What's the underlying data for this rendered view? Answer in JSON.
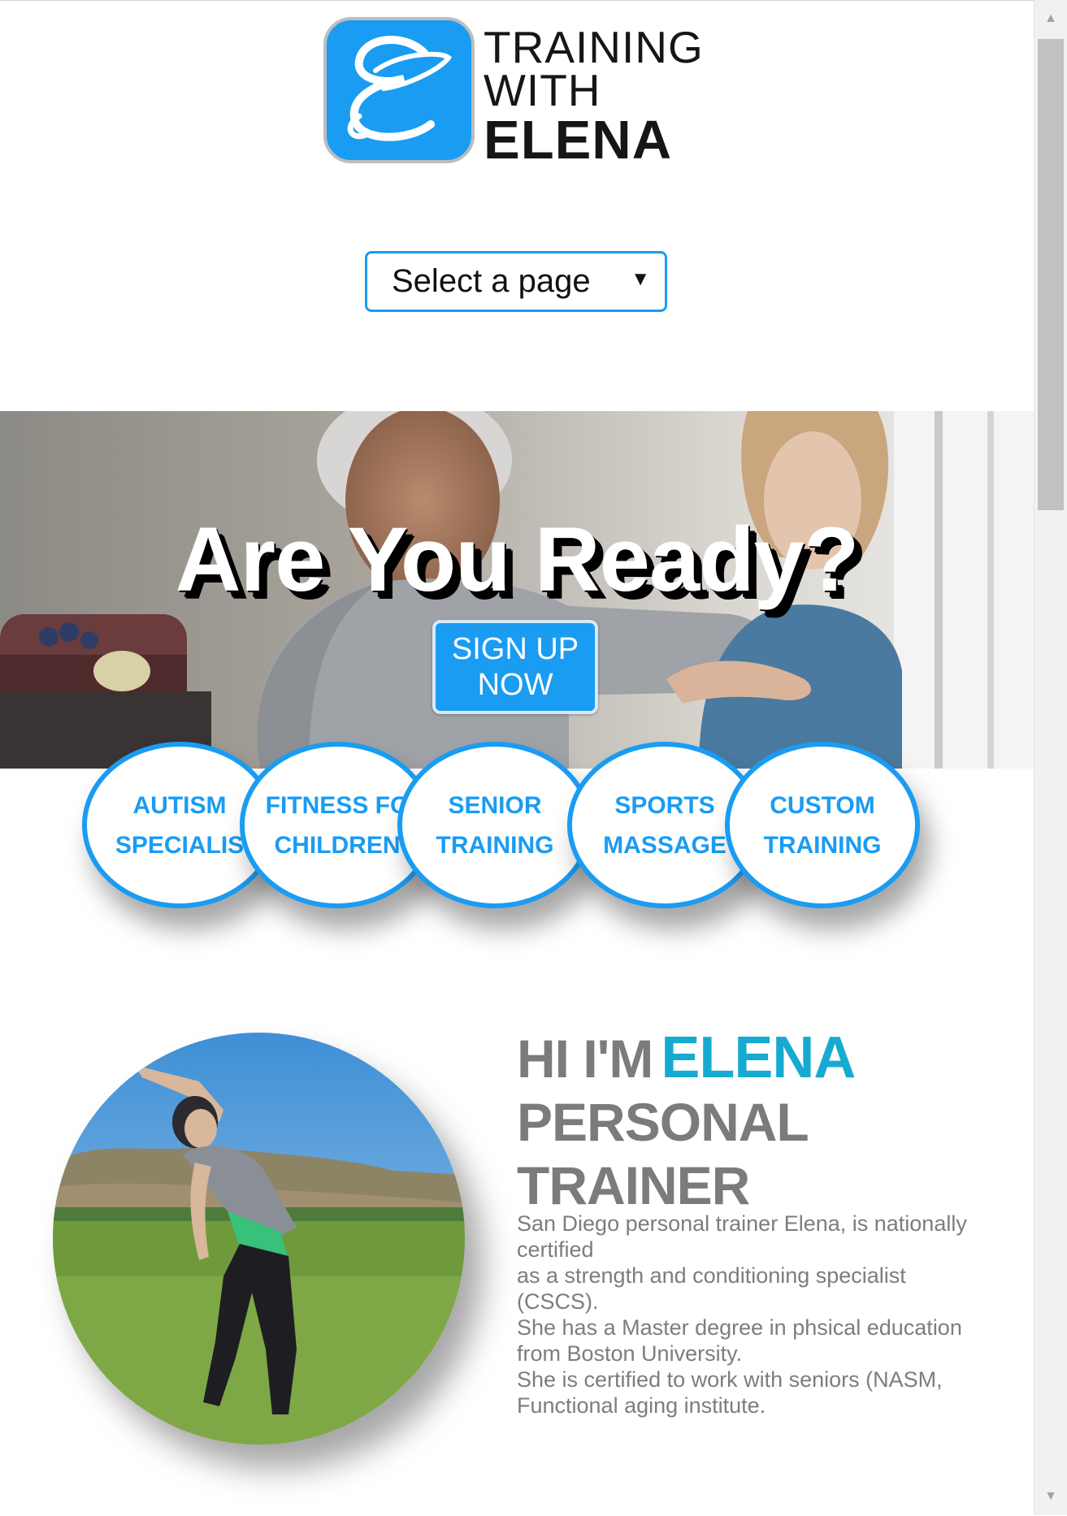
{
  "logo": {
    "line1": "TRAINING",
    "line2": "WITH",
    "line3": "ELENA",
    "badge_letter": "E",
    "color": "#1a9cf2"
  },
  "nav": {
    "select_value": "Select a page",
    "arrow": "▼"
  },
  "hero": {
    "title": "Are You Ready?",
    "cta_line1": "SIGN UP",
    "cta_line2": "NOW"
  },
  "services": [
    {
      "line1": "AUTISM",
      "line2": "SPECIALIS"
    },
    {
      "line1": "FITNESS FO",
      "line2": "CHILDREN"
    },
    {
      "line1": "SENIOR",
      "line2": "TRAINING"
    },
    {
      "line1": "SPORTS",
      "line2": "MASSAGE"
    },
    {
      "line1": "CUSTOM",
      "line2": "TRAINING"
    }
  ],
  "about": {
    "hi": "HI I'M",
    "name": "ELENA",
    "title_line1": "PERSONAL",
    "title_line2": "TRAINER",
    "lines": [
      "San Diego personal trainer Elena, is nationally",
      "certified",
      "as a strength and conditioning specialist",
      "(CSCS).",
      "She has a Master degree in phsical education",
      "from Boston University.",
      "She is certified to work with seniors (NASM,",
      "Functional aging institute."
    ]
  },
  "colors": {
    "accent": "#1a9cf2",
    "name": "#17aad1",
    "text_gray": "#7b7b7b"
  },
  "icons": {
    "scroll_up": "scroll-up-arrow-icon",
    "scroll_down": "scroll-down-arrow-icon"
  }
}
